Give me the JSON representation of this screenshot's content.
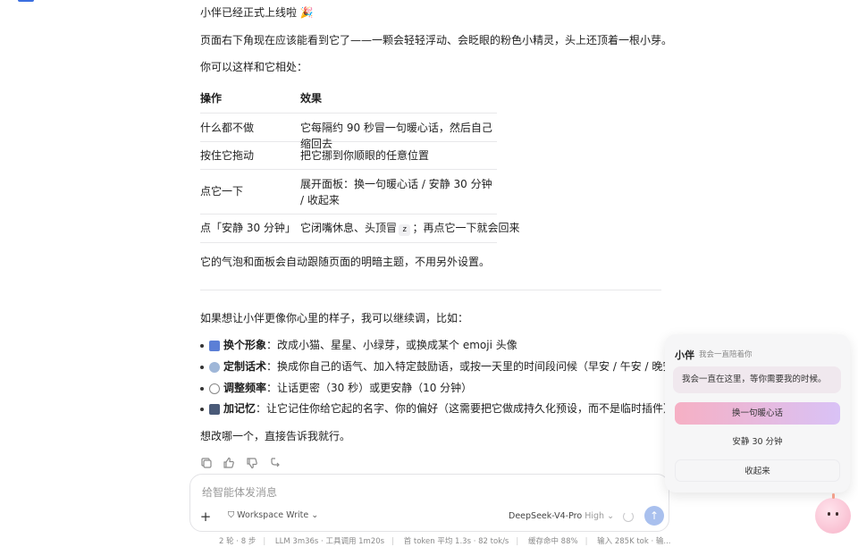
{
  "message": {
    "heading": "小伴已经正式上线啦 🎉",
    "intro": "页面右下角现在应该能看到它了——一颗会轻轻浮动、会眨眼的粉色小精灵，头上还顶着一根小芽。",
    "table_intro": "你可以这样和它相处：",
    "table": {
      "headers": [
        "操作",
        "效果"
      ],
      "rows": [
        {
          "action": "什么都不做",
          "effect": "它每隔约 90 秒冒一句暖心话，然后自己缩回去"
        },
        {
          "action": "按住它拖动",
          "effect": "把它挪到你顺眼的任意位置"
        },
        {
          "action": "点它一下",
          "effect": "展开面板：换一句暖心话 / 安静 30 分钟 / 收起来"
        },
        {
          "action": "点「安静 30 分钟」",
          "effect_before": "它闭嘴休息、头顶冒",
          "effect_kbd": "z",
          "effect_after": "；再点它一下就会回来"
        }
      ]
    },
    "theme_note": "它的气泡和面板会自动跟随页面的明暗主题，不用另外设置。",
    "customize_intro": "如果想让小伴更像你心里的样子，我可以继续调，比如：",
    "bullets": [
      {
        "icon": "mask-icon",
        "icon_color": "#5b7fd6",
        "title": "换个形象",
        "text": "：改成小猫、星星、小绿芽，或换成某个 emoji 头像"
      },
      {
        "icon": "speech-bubble-icon",
        "icon_color": "#9fb7d8",
        "title": "定制话术",
        "text": "：换成你自己的语气、加入特定鼓励语，或按一天里的时间段问候（早安 / 午安 / 晚安）"
      },
      {
        "icon": "stopwatch-icon",
        "icon_color": "#c9c9c9",
        "title": "调整频率",
        "text": "：让话更密（30 秒）或更安静（10 分钟）"
      },
      {
        "icon": "floppy-disk-icon",
        "icon_color": "#4a5a78",
        "title": "加记忆",
        "text": "：让它记住你给它起的名字、你的偏好（这需要把它做成持久化预设，而不是临时插件）"
      }
    ],
    "closing": "想改哪一个，直接告诉我就行。"
  },
  "composer": {
    "placeholder": "给智能体发消息",
    "mode_label": "Workspace Write",
    "model_name": "DeepSeek-V4-Pro",
    "model_level": "High"
  },
  "statusbar": {
    "items": [
      "2 轮 · 8 步",
      "LLM 3m36s · 工具调用 1m20s",
      "首 token 平均 1.3s · 82 tok/s",
      "缓存命中 88%",
      "输入 285K tok · 输..."
    ]
  },
  "companion_panel": {
    "title": "小伴",
    "subtitle": "我会一直陪着你",
    "bubble_text": "我会一直在这里，等你需要我的时候。",
    "buttons": [
      "换一句暖心话",
      "安静 30 分钟",
      "收起来"
    ]
  }
}
